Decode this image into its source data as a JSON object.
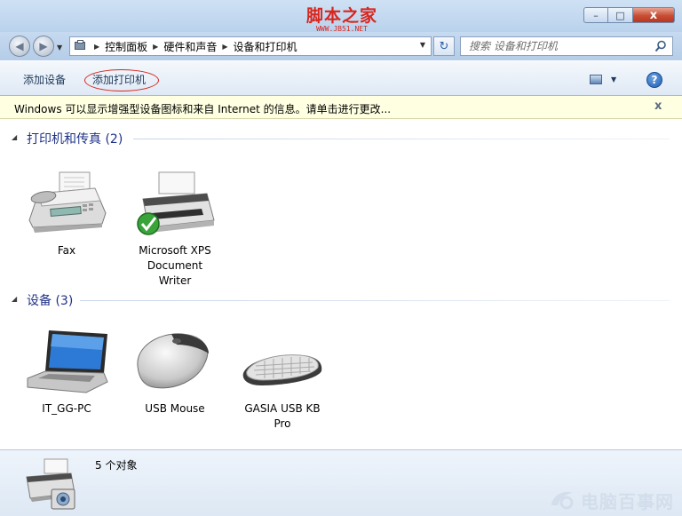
{
  "titlebar": {
    "watermark": {
      "text": "脚本之家",
      "url": "WWW.JB51.NET"
    },
    "buttons": {
      "minimize": "–",
      "maximize": "□",
      "close": "x"
    }
  },
  "nav": {
    "back_glyph": "◀",
    "forward_glyph": "▶",
    "breadcrumb": [
      "控制面板",
      "硬件和声音",
      "设备和打印机"
    ],
    "refresh_glyph": "↻",
    "search_placeholder": "搜索 设备和打印机"
  },
  "commandbar": {
    "add_device": "添加设备",
    "add_printer": "添加打印机",
    "help_glyph": "?"
  },
  "infobar": {
    "text": "Windows 可以显示增强型设备图标和来自 Internet 的信息。请单击进行更改...",
    "close_glyph": "x"
  },
  "groups": [
    {
      "title": "打印机和传真 (2)",
      "items": [
        {
          "label": "Fax",
          "icon": "fax-icon"
        },
        {
          "label": "Microsoft XPS Document Writer",
          "icon": "printer-default-icon"
        }
      ]
    },
    {
      "title": "设备 (3)",
      "items": [
        {
          "label": "IT_GG-PC",
          "icon": "laptop-icon"
        },
        {
          "label": "USB Mouse",
          "icon": "mouse-icon"
        },
        {
          "label": "GASIA USB KB Pro",
          "icon": "keyboard-icon"
        }
      ]
    }
  ],
  "details": {
    "count_text": "5 个对象",
    "icon": "devices-and-printers-icon",
    "brand_watermark": "电脑百事网"
  },
  "colors": {
    "group_title": "#1e3287",
    "command_text": "#1e395b",
    "infobar_bg": "#ffffe1",
    "highlight_ellipse": "#d9251d"
  }
}
